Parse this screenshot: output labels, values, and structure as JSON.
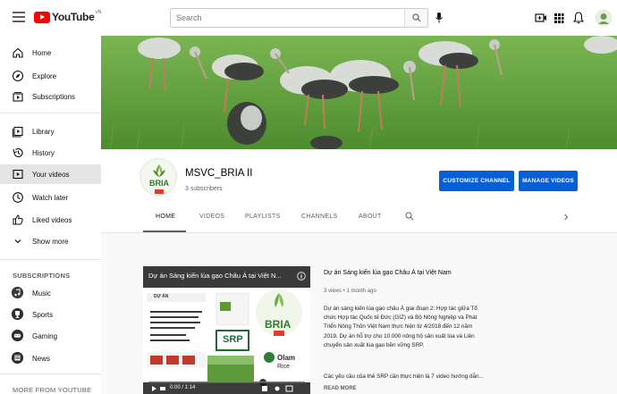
{
  "header": {
    "logo_text": "YouTube",
    "logo_country": "VN",
    "search_placeholder": "Search"
  },
  "sidebar": {
    "items": [
      {
        "label": "Home",
        "icon": "home-icon"
      },
      {
        "label": "Explore",
        "icon": "explore-icon"
      },
      {
        "label": "Subscriptions",
        "icon": "subscriptions-icon"
      },
      {
        "label": "Library",
        "icon": "library-icon"
      },
      {
        "label": "History",
        "icon": "history-icon"
      },
      {
        "label": "Your videos",
        "icon": "your-videos-icon"
      },
      {
        "label": "Watch later",
        "icon": "watch-later-icon"
      },
      {
        "label": "Liked videos",
        "icon": "liked-videos-icon"
      },
      {
        "label": "Show more",
        "icon": "chevron-down-icon"
      }
    ],
    "subscriptions_heading": "SUBSCRIPTIONS",
    "subscriptions": [
      {
        "label": "Music"
      },
      {
        "label": "Sports"
      },
      {
        "label": "Gaming"
      },
      {
        "label": "News"
      }
    ],
    "more_heading": "MORE FROM YOUTUBE"
  },
  "channel": {
    "name": "MSVC_BRIA II",
    "subscribers": "3 subscribers",
    "avatar_text": "BRIA",
    "customize_label": "CUSTOMIZE CHANNEL",
    "manage_label": "MANAGE VIDEOS",
    "tabs": [
      "HOME",
      "VIDEOS",
      "PLAYLISTS",
      "CHANNELS",
      "ABOUT"
    ]
  },
  "featured": {
    "player_title": "Dự án Sáng kiến lúa gạo Châu Á tại Việt N...",
    "player_time": "0:00 / 1:14",
    "slide_texts": {
      "left_heading": "DỰ ÁN",
      "bria": "BRIA",
      "srp": "SRP",
      "olam": "Olam",
      "rice": "Rice"
    },
    "title": "Dự án Sáng kiến lúa gạo Châu Á tại Việt Nam",
    "meta": "3 views • 1 month ago",
    "description": "Dự án sáng kiến lúa gạo châu Á giai đoạn 2: Hợp tác giữa Tổ chức Hợp tác Quốc tế Đức (GIZ) và Bộ Nông Nghiệp và Phát Triển Nông Thôn Việt Nam thực hiện từ 4/2018 đến 12 năm 2019. Dự án hỗ trợ cho 10.000 nông hộ sản xuất lúa và Liên chuyển sản xuất lúa gạo bền vững SRP.",
    "description2": "Các yêu cầu của thẻ SRP cần thực hiện là 7 video hướng dẫn...",
    "read_more": "READ MORE"
  }
}
